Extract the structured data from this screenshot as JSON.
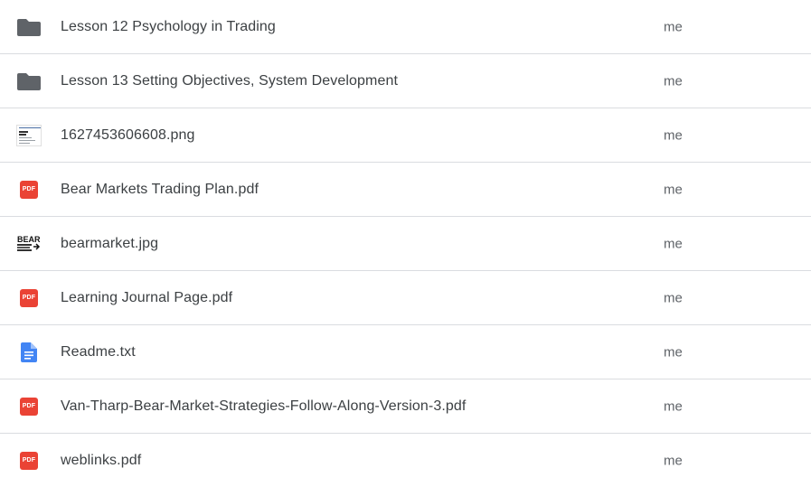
{
  "files": [
    {
      "name": "Lesson 12 Psychology in Trading",
      "owner": "me",
      "icon": "folder-icon"
    },
    {
      "name": "Lesson 13 Setting Objectives, System Development",
      "owner": "me",
      "icon": "folder-icon"
    },
    {
      "name": "1627453606608.png",
      "owner": "me",
      "icon": "image-thumbnail"
    },
    {
      "name": "Bear Markets Trading Plan.pdf",
      "owner": "me",
      "icon": "pdf-icon"
    },
    {
      "name": "bearmarket.jpg",
      "owner": "me",
      "icon": "image-thumbnail"
    },
    {
      "name": "Learning Journal Page.pdf",
      "owner": "me",
      "icon": "pdf-icon"
    },
    {
      "name": "Readme.txt",
      "owner": "me",
      "icon": "document-icon"
    },
    {
      "name": "Van-Tharp-Bear-Market-Strategies-Follow-Along-Version-3.pdf",
      "owner": "me",
      "icon": "pdf-icon"
    },
    {
      "name": "weblinks.pdf",
      "owner": "me",
      "icon": "pdf-icon"
    }
  ],
  "pdf_badge_text": "PDF",
  "thumbnail_text": "BEAR",
  "colors": {
    "folder": "#5f6368",
    "pdf": "#ea4335",
    "doc": "#4285f4",
    "divider": "#dadce0",
    "text": "#3c4043"
  }
}
